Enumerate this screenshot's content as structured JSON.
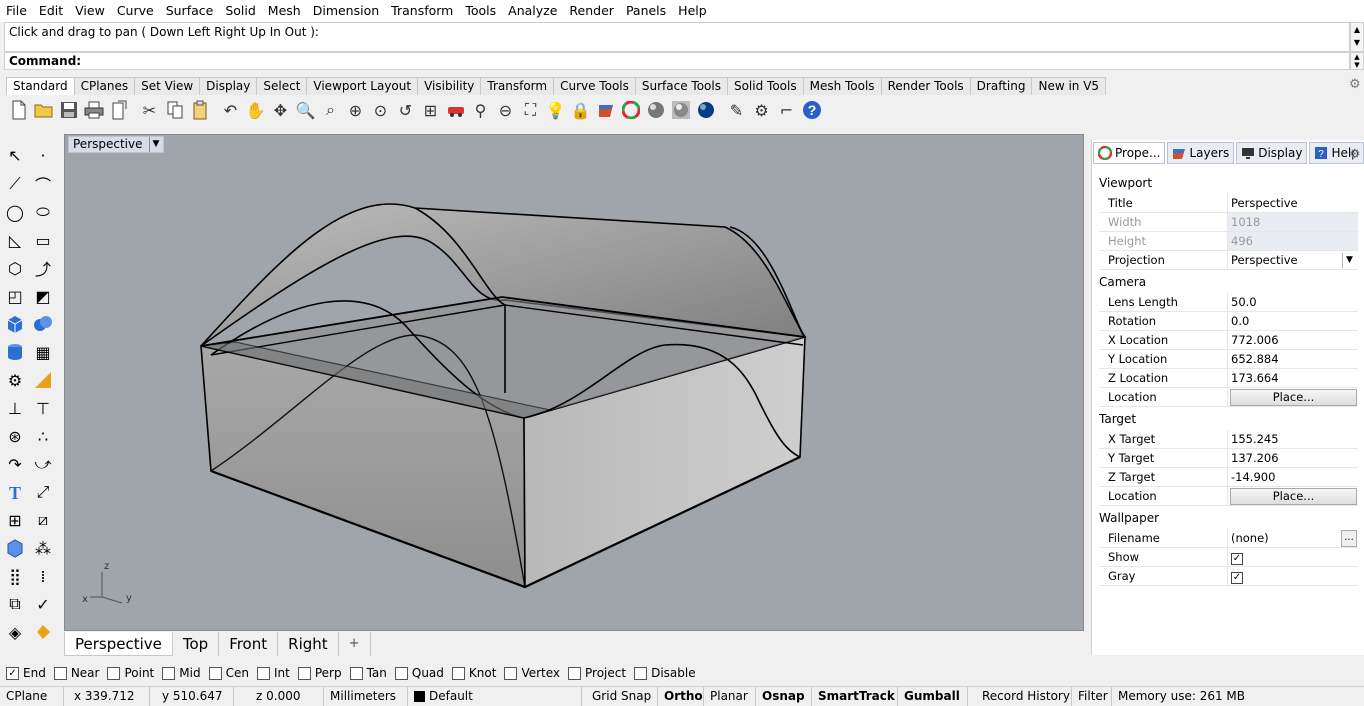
{
  "menu": [
    "File",
    "Edit",
    "View",
    "Curve",
    "Surface",
    "Solid",
    "Mesh",
    "Dimension",
    "Transform",
    "Tools",
    "Analyze",
    "Render",
    "Panels",
    "Help"
  ],
  "command": {
    "history": "Click and drag to pan ( Down  Left  Right  Up  In  Out ):",
    "prompt": "Command:"
  },
  "toolbar_tabs": [
    "Standard",
    "CPlanes",
    "Set View",
    "Display",
    "Select",
    "Viewport Layout",
    "Visibility",
    "Transform",
    "Curve Tools",
    "Surface Tools",
    "Solid Tools",
    "Mesh Tools",
    "Render Tools",
    "Drafting",
    "New in V5"
  ],
  "viewport": {
    "title": "Perspective",
    "axes": {
      "z": "z",
      "x": "x",
      "y": "y"
    },
    "tabs": [
      "Perspective",
      "Top",
      "Front",
      "Right"
    ],
    "add_tab": "+"
  },
  "panel": {
    "tabs": [
      "Prope...",
      "Layers",
      "Display",
      "Help"
    ],
    "sections": {
      "viewport": "Viewport",
      "camera": "Camera",
      "target": "Target",
      "wallpaper": "Wallpaper"
    },
    "viewport_rows": [
      {
        "k": "Title",
        "v": "Perspective"
      },
      {
        "k": "Width",
        "v": "1018"
      },
      {
        "k": "Height",
        "v": "496"
      },
      {
        "k": "Projection",
        "v": "Perspective"
      }
    ],
    "camera_rows": [
      {
        "k": "Lens Length",
        "v": "50.0"
      },
      {
        "k": "Rotation",
        "v": "0.0"
      },
      {
        "k": "X Location",
        "v": "772.006"
      },
      {
        "k": "Y Location",
        "v": "652.884"
      },
      {
        "k": "Z Location",
        "v": "173.664"
      },
      {
        "k": "Location",
        "v": "Place..."
      }
    ],
    "target_rows": [
      {
        "k": "X Target",
        "v": "155.245"
      },
      {
        "k": "Y Target",
        "v": "137.206"
      },
      {
        "k": "Z Target",
        "v": "-14.900"
      },
      {
        "k": "Location",
        "v": "Place..."
      }
    ],
    "wallpaper_rows": [
      {
        "k": "Filename",
        "v": "(none)"
      },
      {
        "k": "Show",
        "v": "checked"
      },
      {
        "k": "Gray",
        "v": "checked"
      }
    ]
  },
  "osnaps": [
    {
      "label": "End",
      "checked": true
    },
    {
      "label": "Near",
      "checked": false
    },
    {
      "label": "Point",
      "checked": false
    },
    {
      "label": "Mid",
      "checked": false
    },
    {
      "label": "Cen",
      "checked": false
    },
    {
      "label": "Int",
      "checked": false
    },
    {
      "label": "Perp",
      "checked": false
    },
    {
      "label": "Tan",
      "checked": false
    },
    {
      "label": "Quad",
      "checked": false
    },
    {
      "label": "Knot",
      "checked": false
    },
    {
      "label": "Vertex",
      "checked": false
    },
    {
      "label": "Project",
      "checked": false
    },
    {
      "label": "Disable",
      "checked": false
    }
  ],
  "status": {
    "cplane": "CPlane",
    "x": "x 339.712",
    "y": "y 510.647",
    "z": "z 0.000",
    "units": "Millimeters",
    "layer": "Default",
    "grid_snap": "Grid Snap",
    "ortho": "Ortho",
    "planar": "Planar",
    "osnap": "Osnap",
    "smarttrack": "SmartTrack",
    "gumball": "Gumball",
    "record_history": "Record History",
    "filter": "Filter",
    "memory": "Memory use: 261 MB"
  },
  "colors": {
    "viewport_bg": "#a0a5ab",
    "accent": "#d6dde8"
  }
}
